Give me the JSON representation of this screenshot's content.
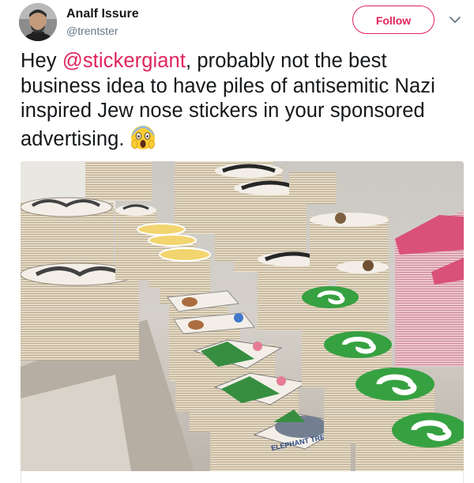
{
  "author": {
    "name": "Analf Issure",
    "handle": "@trentster"
  },
  "follow_button": {
    "label": "Follow"
  },
  "tweet": {
    "text_before": "Hey ",
    "mention": "@stickergiant",
    "text_after": ", probably not the best business idea to have piles of antisemitic Nazi inspired Jew nose stickers in your sponsored advertising.",
    "emoji": "face-screaming-in-fear"
  },
  "media": {
    "description_icons": [
      "round-green-swirl-sticker",
      "pink-triangle-sticker",
      "tree-sticker",
      "elephant-sticker"
    ],
    "sticker_lettering": {
      "elephant_sticker": "ELEPHANT TREE"
    }
  },
  "colors": {
    "accent": "#e0245e",
    "text": "#14171a",
    "secondary_text": "#657786",
    "sticker_green": "#2e9e3a",
    "sticker_pink": "#d94a73"
  },
  "icons": {
    "caret": "chevron-down-icon"
  }
}
